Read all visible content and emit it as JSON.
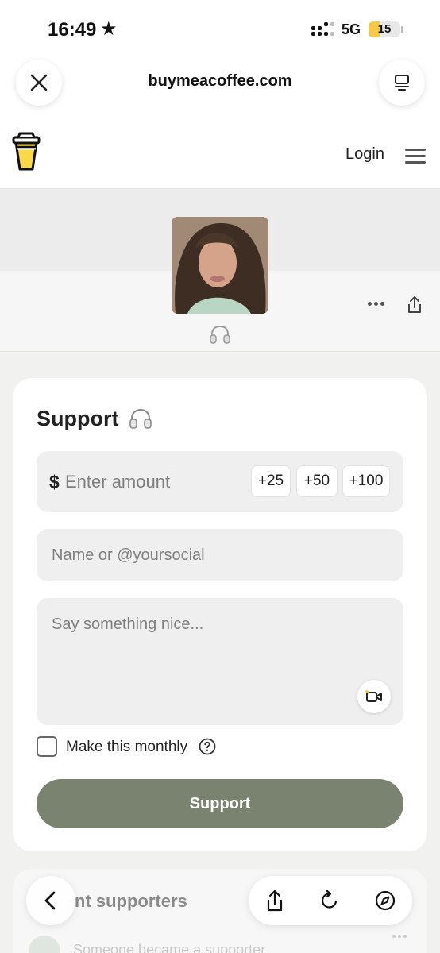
{
  "status_bar": {
    "time": "16:49",
    "network": "5G",
    "battery": "15",
    "battery_level": 0.15
  },
  "browser": {
    "url": "buymeacoffee.com"
  },
  "site_header": {
    "login_label": "Login"
  },
  "support_card": {
    "title": "Support",
    "currency_symbol": "$",
    "amount_placeholder": "Enter amount",
    "quick_amounts": [
      "+25",
      "+50",
      "+100"
    ],
    "name_placeholder": "Name or @yoursocial",
    "message_placeholder": "Say something nice...",
    "monthly_label": "Make this monthly",
    "submit_label": "Support"
  },
  "supporters": {
    "title_visible": "nt supporters",
    "first_item_text": "Someone became a supporter"
  },
  "colors": {
    "accent_button": "#7a8270",
    "logo_yellow": "#f9d84a"
  }
}
